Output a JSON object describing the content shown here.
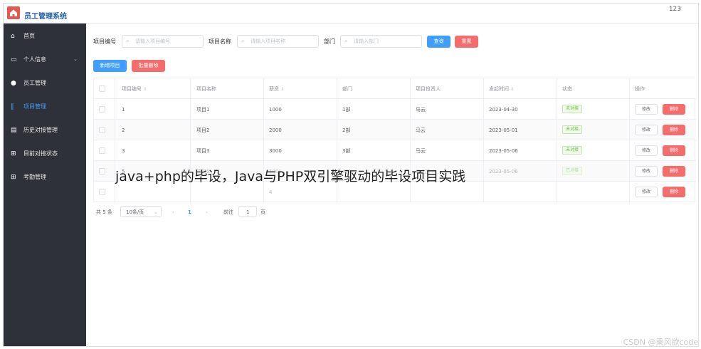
{
  "app": {
    "title": "员工管理系统",
    "user": "123"
  },
  "sidebar": {
    "items": [
      {
        "label": "首页",
        "icon": "dashboard-icon",
        "glyph": "⌂"
      },
      {
        "label": "个人信息",
        "icon": "id-card-icon",
        "glyph": "▭",
        "expandable": true
      },
      {
        "label": "员工管理",
        "icon": "user-icon",
        "glyph": "●"
      },
      {
        "label": "项目管理",
        "icon": "project-icon",
        "glyph": "‖",
        "active": true
      },
      {
        "label": "历史对接管理",
        "icon": "history-icon",
        "glyph": "▤"
      },
      {
        "label": "目前对接状态",
        "icon": "grid-icon",
        "glyph": "⊞"
      },
      {
        "label": "考勤管理",
        "icon": "grid-icon",
        "glyph": "⊞"
      }
    ]
  },
  "filters": {
    "project_no": {
      "label": "项目编号",
      "placeholder": "请输入项目编号"
    },
    "project_name": {
      "label": "项目名称",
      "placeholder": "请输入项目名称"
    },
    "department": {
      "label": "部门",
      "placeholder": "请输入部门"
    },
    "query_label": "查询",
    "reset_label": "重置"
  },
  "toolbar": {
    "add_label": "新增项目",
    "batch_delete_label": "批量删除"
  },
  "table": {
    "columns": [
      "项目编号",
      "项目名称",
      "薪资",
      "部门",
      "项目投资人",
      "发起时间",
      "状态",
      "操作"
    ],
    "rows": [
      {
        "id": "1",
        "name": "项目1",
        "salary": "1000",
        "dept": "1部",
        "investor": "马云",
        "date": "2023-04-30",
        "status": "未对接"
      },
      {
        "id": "2",
        "name": "项目2",
        "salary": "2000",
        "dept": "2部",
        "investor": "马云",
        "date": "2023-05-01",
        "status": "未对接"
      },
      {
        "id": "3",
        "name": "项目3",
        "salary": "3000",
        "dept": "3部",
        "investor": "马云",
        "date": "2023-05-06",
        "status": "未对接"
      },
      {
        "id": "5",
        "name": "项目5",
        "salary": "5000",
        "dept": "4部",
        "investor": "马化腾",
        "date": "2023-05-06",
        "status": "已对接"
      },
      {
        "id": "",
        "name": "",
        "salary": "4",
        "dept": "",
        "investor": "",
        "date": "",
        "status": ""
      }
    ],
    "edit_label": "修改",
    "delete_label": "删除"
  },
  "pagination": {
    "total_text": "共 5 条",
    "page_size": "10条/页",
    "current_page": "1",
    "goto_label": "前往",
    "goto_value": "1",
    "page_suffix": "页"
  },
  "overlay": {
    "caption": "java+php的毕设，Java与PHP双引擎驱动的毕设项目实践",
    "watermark": "CSDN @乘风欲code"
  },
  "colors": {
    "primary": "#409eff",
    "danger": "#f56c6c",
    "sidebar_bg": "#2e3238",
    "success": "#67c23a"
  }
}
